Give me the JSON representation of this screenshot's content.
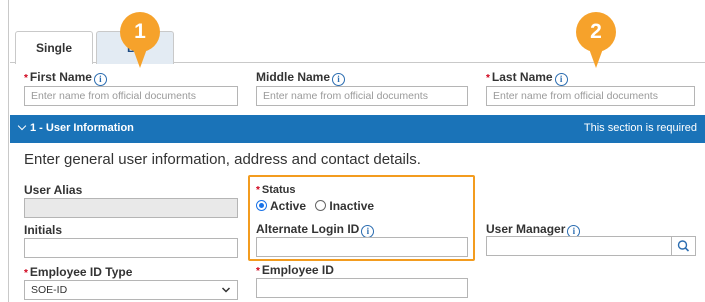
{
  "tabs": [
    {
      "label": "Single"
    },
    {
      "label": "Bu"
    }
  ],
  "badges": [
    "1",
    "2"
  ],
  "name_fields": {
    "first_name": {
      "label": "First Name",
      "placeholder": "Enter name from official documents"
    },
    "middle_name": {
      "label": "Middle Name",
      "placeholder": "Enter name from official documents"
    },
    "last_name": {
      "label": "Last Name",
      "placeholder": "Enter name from official documents"
    }
  },
  "section": {
    "title": "1 - User Information",
    "note": "This section is required",
    "description": "Enter general user information, address and contact details."
  },
  "fields": {
    "user_alias": {
      "label": "User Alias",
      "value": ""
    },
    "initials": {
      "label": "Initials",
      "value": ""
    },
    "status": {
      "label": "Status",
      "options": [
        "Active",
        "Inactive"
      ],
      "selected": "Active"
    },
    "alternate_login_id": {
      "label": "Alternate Login ID",
      "value": ""
    },
    "user_manager": {
      "label": "User Manager",
      "value": ""
    },
    "employee_id_type": {
      "label": "Employee ID Type",
      "value": "SOE-ID"
    },
    "employee_id": {
      "label": "Employee ID",
      "value": ""
    }
  },
  "required_mark": "*",
  "info_glyph": "i",
  "icons": {
    "info": "info-icon",
    "search": "search-icon",
    "chevron": "chevron-down-icon",
    "caret": "caret-down-icon"
  },
  "colors": {
    "accent": "#1a73b8",
    "highlight": "#f39c1f",
    "badge": "#f6a22b",
    "required": "#d0021b"
  }
}
